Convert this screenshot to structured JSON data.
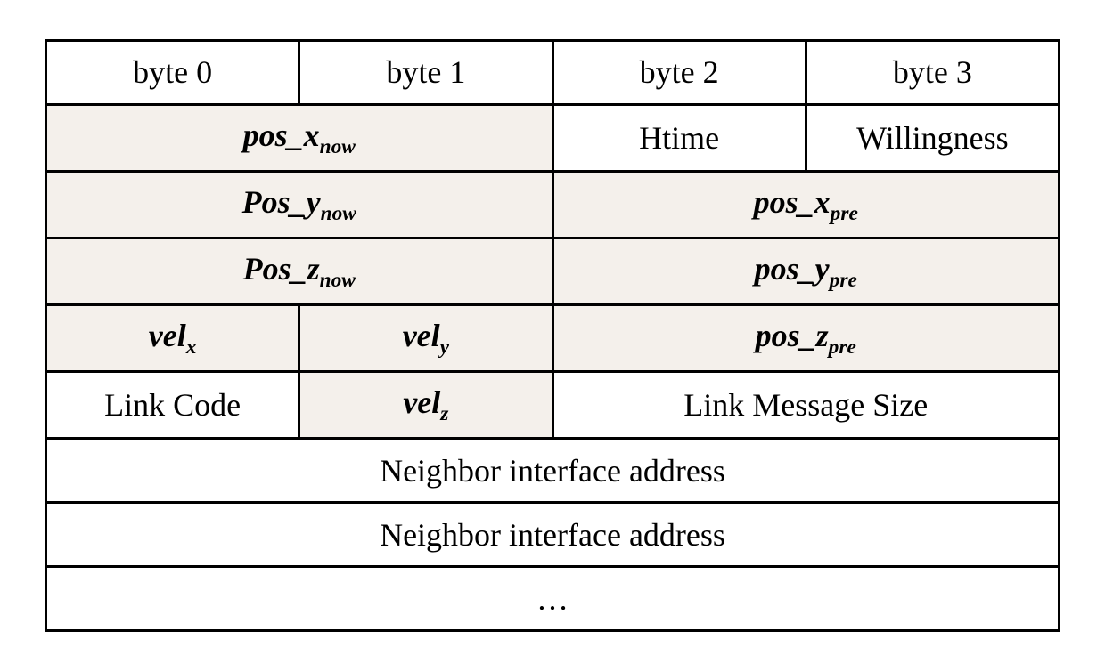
{
  "header": {
    "b0": "byte 0",
    "b1": "byte 1",
    "b2": "byte 2",
    "b3": "byte 3"
  },
  "rows": {
    "r1": {
      "pos_x_now_prefix": "pos",
      "pos_x_now_var": "_x",
      "pos_x_now_sub": "now",
      "htime": "Htime",
      "willingness": "Willingness"
    },
    "r2": {
      "pos_y_now_prefix": "Pos",
      "pos_y_now_var": "_y",
      "pos_y_now_sub": "now",
      "pos_x_pre_prefix": "pos",
      "pos_x_pre_var": "_x",
      "pos_x_pre_sub": "pre"
    },
    "r3": {
      "pos_z_now_prefix": "Pos",
      "pos_z_now_var": "_z",
      "pos_z_now_sub": "now",
      "pos_y_pre_prefix": "pos",
      "pos_y_pre_var": "_y",
      "pos_y_pre_sub": "pre"
    },
    "r4": {
      "vel_x_prefix": "vel",
      "vel_x_sub": "x",
      "vel_y_prefix": "vel",
      "vel_y_sub": "y",
      "pos_z_pre_prefix": "pos",
      "pos_z_pre_var": "_z",
      "pos_z_pre_sub": "pre"
    },
    "r5": {
      "link_code": "Link Code",
      "vel_z_prefix": "vel",
      "vel_z_sub": "z",
      "link_msg_size": "Link Message Size"
    },
    "r6": {
      "neighbor1": "Neighbor interface address"
    },
    "r7": {
      "neighbor2": "Neighbor interface address"
    },
    "r8": {
      "ellipsis": "…"
    }
  }
}
